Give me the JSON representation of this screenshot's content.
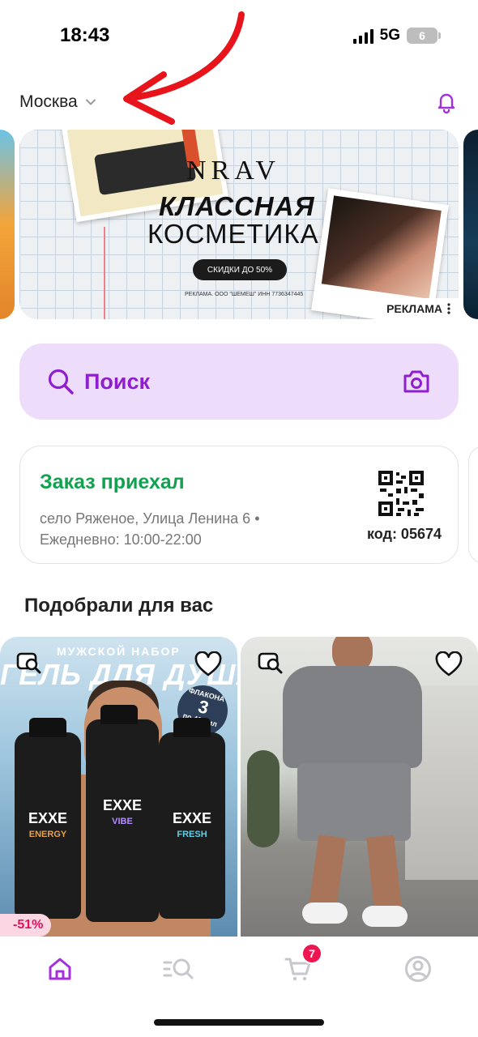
{
  "status_bar": {
    "time": "18:43",
    "network": "5G",
    "battery": "6"
  },
  "header": {
    "city": "Москва",
    "icons": {
      "chevron": "chevron-down-icon",
      "notifications": "bell-icon"
    }
  },
  "banner": {
    "brand": "NRAV",
    "title_line1": "КЛАССНАЯ",
    "title_line2": "КОСМЕТИКА",
    "pill_text": "СКИДКИ ДО 50%",
    "legal": "РЕКЛАМА. ООО \"ШЕМЕШ\" ИНН 7736347445",
    "ad_label": "РЕКЛАМА"
  },
  "search": {
    "label": "Поиск",
    "icons": {
      "search": "search-icon",
      "camera": "camera-icon"
    }
  },
  "order": {
    "status": "Заказ приехал",
    "address": "село Ряженое, Улица Ленина 6 •",
    "hours": "Ежедневно: 10:00-22:00",
    "code": "код: 05674"
  },
  "recommendations": {
    "title": "Подобрали для вас",
    "products": [
      {
        "tag": "МУЖСКОЙ НАБОР",
        "headline": "ГЕЛЬ ДЛЯ ДУША",
        "badge_line1": "ФЛАКОНА",
        "badge_line2": "3",
        "badge_line3": "по 400 мл",
        "bottles": [
          {
            "brand": "EXXE",
            "variant": "ENERGY"
          },
          {
            "brand": "EXXE",
            "variant": "VIBE"
          },
          {
            "brand": "EXXE",
            "variant": "FRESH"
          }
        ],
        "discount": "-51%"
      },
      {}
    ]
  },
  "tab_bar": {
    "cart_count": "7",
    "active_color": "#a42fe0",
    "inactive_color": "#c7c7cc"
  },
  "colors": {
    "accent": "#8e1fcf",
    "search_bg": "#eddcfa",
    "success": "#11a24f",
    "badge": "#ee1550",
    "annotation_arrow": "#e8141c"
  }
}
